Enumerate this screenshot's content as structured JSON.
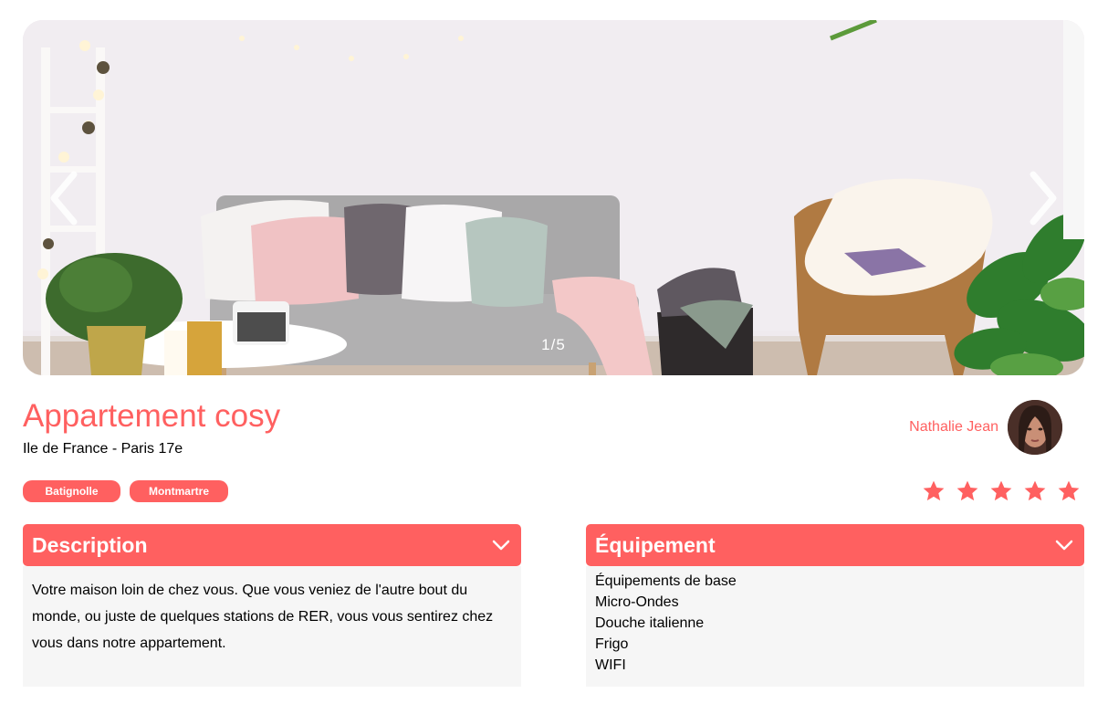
{
  "carousel": {
    "counter": "1/5",
    "prev_icon": "chevron-left-icon",
    "next_icon": "chevron-right-icon"
  },
  "listing": {
    "title": "Appartement cosy",
    "location": "Ile de France - Paris 17e",
    "tags": [
      "Batignolle",
      "Montmartre"
    ],
    "rating": 5,
    "rating_max": 5
  },
  "host": {
    "name": "Nathalie Jean"
  },
  "description": {
    "title": "Description",
    "text": "Votre maison loin de chez vous. Que vous veniez de l'autre bout du monde, ou juste de quelques stations de RER, vous vous sentirez chez vous dans notre appartement."
  },
  "equipment": {
    "title": "Équipement",
    "items": [
      "Équipements de base",
      "Micro-Ondes",
      "Douche italienne",
      "Frigo",
      "WIFI"
    ]
  },
  "colors": {
    "accent": "#ff6060",
    "panel_bg": "#f6f6f6",
    "star_empty": "#e3e3e3"
  }
}
